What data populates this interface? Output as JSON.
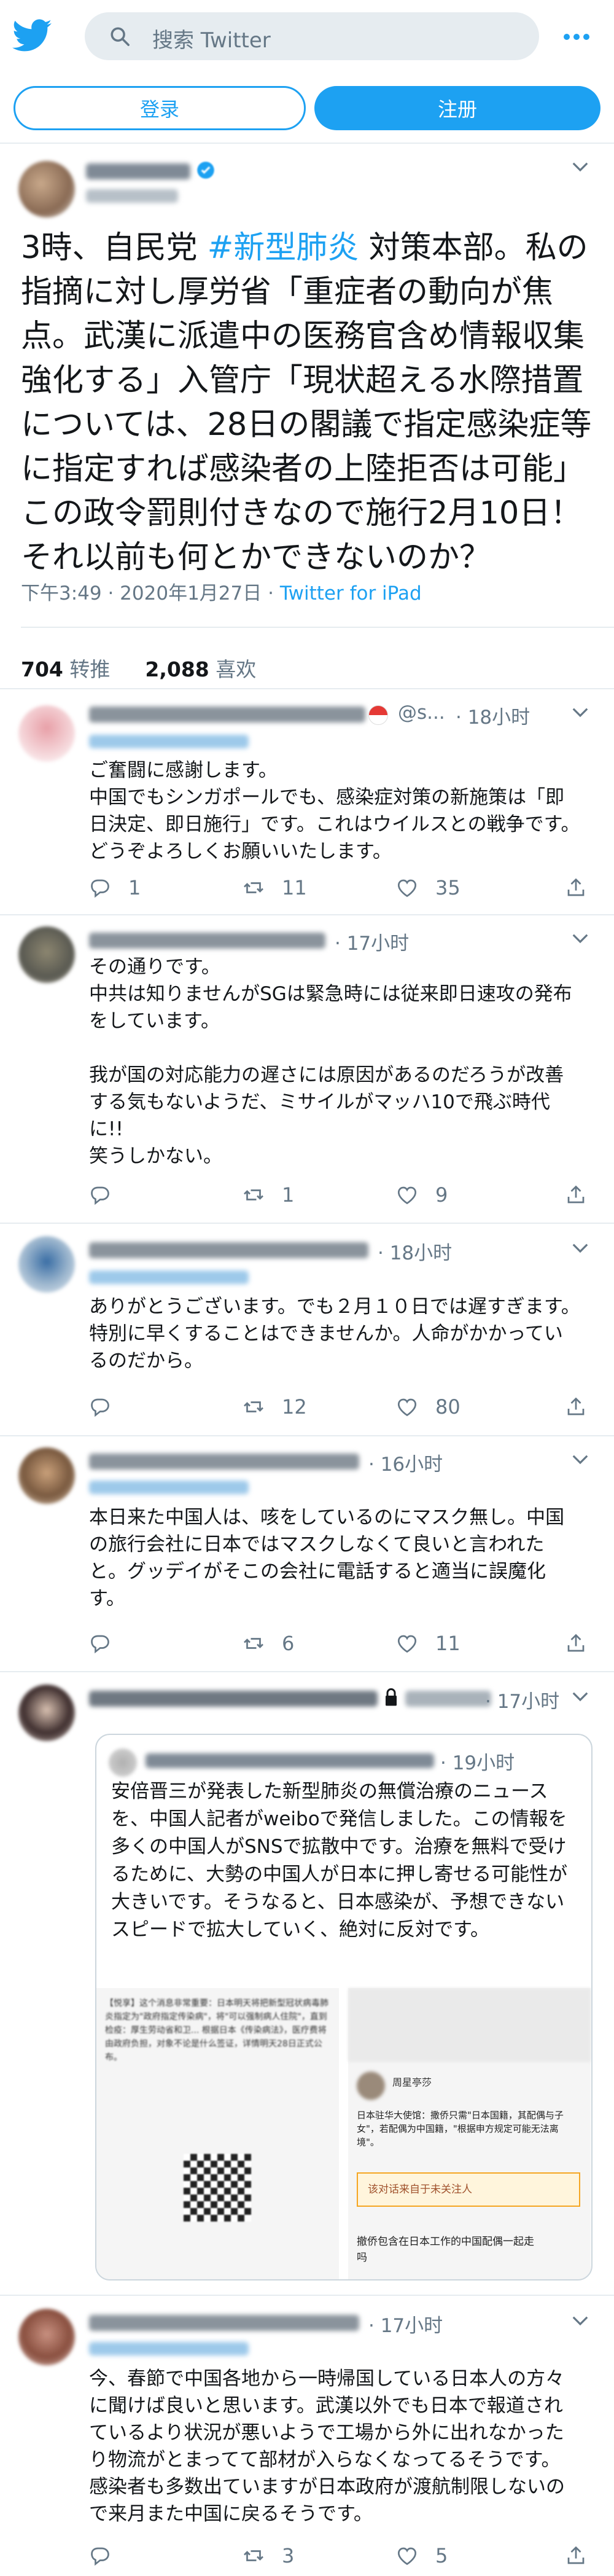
{
  "header": {
    "search_placeholder": "搜索 Twitter",
    "login_label": "登录",
    "signup_label": "注册"
  },
  "tweet": {
    "text_before_hashtag": "3時、自民党 ",
    "hashtag": "#新型肺炎",
    "text_after_hashtag": " 対策本部。私の指摘に対し厚労省「重症者の動向が焦点。武漢に派遣中の医務官含め情報収集強化する」入管庁「現状超える水際措置については、28日の閣議で指定感染症等に指定すれば感染者の上陸拒否は可能」この政令罰則付きなので施行2月10日！それ以前も何とかできないのか？",
    "time": "下午3:49 · 2020年1月27日 · ",
    "source": "Twitter for iPad",
    "retweets": "704",
    "retweets_label": " 转推",
    "likes": "2,088",
    "likes_label": " 喜欢"
  },
  "replies": [
    {
      "handle_suffix": "@s...",
      "time": "· 18小时",
      "text": "ご奮闘に感謝します。\n中国でもシンガポールでも、感染症対策の新施策は「即日決定、即日施行」です。これはウイルスとの戦争です。どうぞよろしくお願いいたします。",
      "reply_count": "1",
      "retweet_count": "11",
      "like_count": "35"
    },
    {
      "time": "· 17小时",
      "text": "その通りです。\n中共は知りませんがSGは緊急時には従来即日速攻の発布をしています。\n\n我が国の対応能力の遅さには原因があるのだろうが改善する気もないようだ、ミサイルがマッハ10で飛ぶ時代に!!\n笑うしかない。",
      "reply_count": "",
      "retweet_count": "1",
      "like_count": "9"
    },
    {
      "time": "· 18小时",
      "text": "ありがとうございます。でも２月１０日では遅すぎます。特別に早くすることはできませんか。人命がかかっているのだから。",
      "reply_count": "",
      "retweet_count": "12",
      "like_count": "80"
    },
    {
      "time": "· 16小时",
      "text": "本日来た中国人は、咳をしているのにマスク無し。中国の旅行会社に日本ではマスクしなくて良いと言われたと。グッデイがそこの会社に電話すると適当に誤魔化す。",
      "reply_count": "",
      "retweet_count": "6",
      "like_count": "11"
    },
    {
      "time": "· 17小时",
      "reply_count": "",
      "retweet_count": "",
      "like_count": ""
    },
    {
      "time": "· 17小时",
      "text": "今、春節で中国各地から一時帰国している日本人の方々に聞けば良いと思います。武漢以外でも日本で報道されているより状況が悪いようで工場から外に出れなかったり物流がとまってて部材が入らなくなってるそうです。\n感染者も多数出ていますが日本政府が渡航制限しないので来月また中国に戻るそうです。",
      "reply_count": "",
      "retweet_count": "3",
      "like_count": "5"
    }
  ],
  "quote": {
    "time": "· 19小时",
    "text": "安倍晋三が発表した新型肺炎の無償治療のニュースを、中国人記者がweiboで発信しました。この情報を多くの中国人がSNSで拡散中です。治療を無料で受けるために、大勢の中国人が日本に押し寄せる可能性が大きいです。そうなると、日本感染が、予想できないスピードで拡大していく、絶対に反対です。",
    "left_image_text": "【悦享】这个消息非常重要：日本明天将把新型冠状病毒肺炎指定为\"政府指定传染病\"，将\"可以强制病人住院\"，直到检疫：厚生劳动省和卫... 根据日本《传染病法》，医疗费将由政府负担，对象不论是什么签证，详情明天28日正式公布。",
    "right_image_header": "周星亭莎",
    "right_image_text": "日本驻华大使馆：撒侨只需\"日本国籍，其配偶与子女\"，若配偶为中国籍，\"根据申方规定可能无法离境\"。",
    "right_image_warn": "该对话来自于未关注人",
    "right_image_bottom": "撤侨包含在日本工作的中国配偶一起走吗"
  },
  "colors": {
    "accent": "#1da1f2",
    "text": "#14171a",
    "muted": "#657786",
    "divider": "#e6ecf0"
  },
  "icons": [
    "twitter-bird-icon",
    "search-icon",
    "more-dots-icon",
    "chevron-down-icon",
    "reply-icon",
    "retweet-icon",
    "like-icon",
    "share-icon",
    "verified-icon",
    "lock-icon"
  ]
}
